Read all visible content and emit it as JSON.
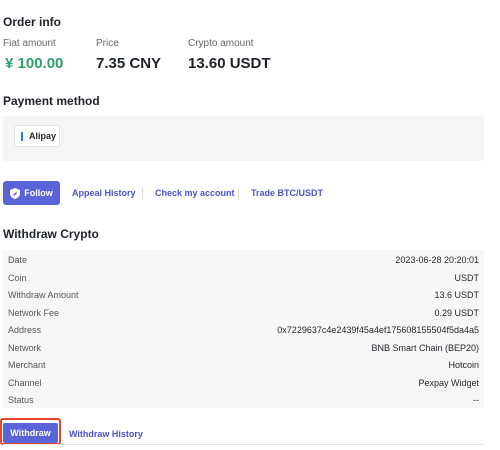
{
  "order_info": {
    "title": "Order info",
    "fiat_amount_label": "Fiat amount",
    "fiat_amount_value": "¥ 100.00",
    "price_label": "Price",
    "price_value": "7.35 CNY",
    "crypto_amount_label": "Crypto amount",
    "crypto_amount_value": "13.60 USDT"
  },
  "payment": {
    "title": "Payment method",
    "method": "Alipay"
  },
  "actions": {
    "follow_label": "Follow",
    "appeal_history": "Appeal History",
    "check_account": "Check my account",
    "trade": "Trade BTC/USDT"
  },
  "withdraw": {
    "title": "Withdraw Crypto",
    "rows": [
      {
        "label": "Date",
        "value": "2023-06-28 20:20:01"
      },
      {
        "label": "Coin",
        "value": "USDT"
      },
      {
        "label": "Withdraw Amount",
        "value": "13.6 USDT"
      },
      {
        "label": "Network Fee",
        "value": "0.29 USDT"
      },
      {
        "label": "Address",
        "value": "0x7229637c4e2439f45a4ef175608155504f5da4a5"
      },
      {
        "label": "Network",
        "value": "BNB Smart Chain (BEP20)"
      },
      {
        "label": "Merchant",
        "value": "Hotcoin"
      },
      {
        "label": "Channel",
        "value": "Pexpay Widget"
      },
      {
        "label": "Status",
        "value": "--"
      }
    ],
    "withdraw_button": "Withdraw",
    "history_link": "Withdraw History"
  },
  "colors": {
    "accent": "#5a63d8",
    "link": "#4a52c8",
    "fiat_green": "#2ea06a",
    "highlight": "#e8452c",
    "alipay_blue": "#1677ff"
  }
}
